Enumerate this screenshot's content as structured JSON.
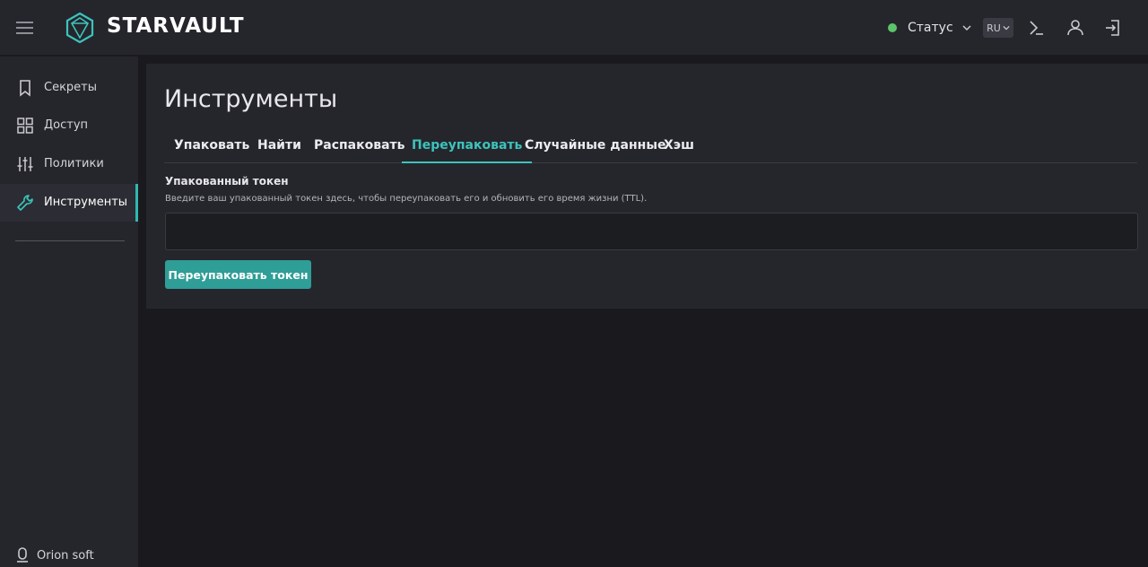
{
  "header": {
    "brand": "STARVAULT",
    "status_label": "Статус",
    "lang": "RU",
    "icons": [
      "menu-icon",
      "logo-icon",
      "chevron-down-icon",
      "terminal-icon",
      "user-icon",
      "logout-icon"
    ],
    "status_color": "#5cc46a"
  },
  "sidebar": {
    "items": [
      {
        "label": "Секреты",
        "icon": "bookmark-icon",
        "active": false
      },
      {
        "label": "Доступ",
        "icon": "grid-icon",
        "active": false
      },
      {
        "label": "Политики",
        "icon": "sliders-icon",
        "active": false
      },
      {
        "label": "Инструменты",
        "icon": "wrench-icon",
        "active": true
      }
    ],
    "footer": "Orion soft"
  },
  "main": {
    "title": "Инструменты",
    "tabs": [
      {
        "label": "Упаковать",
        "active": false
      },
      {
        "label": "Найти",
        "active": false
      },
      {
        "label": "Распаковать",
        "active": false
      },
      {
        "label": "Переупаковать",
        "active": true
      },
      {
        "label": "Случайные данные",
        "active": false
      },
      {
        "label": "Хэш",
        "active": false
      }
    ],
    "field_label": "Упакованный токен",
    "field_help": "Введите ваш упакованный токен здесь, чтобы переупаковать его и обновить его время жизни (TTL).",
    "token_value": "",
    "token_placeholder": "",
    "submit_label": "Переупаковать токен"
  },
  "colors": {
    "accent": "#3cc4bc",
    "button": "#2e9e97",
    "background": "#1a1a1e",
    "panel": "#25262c"
  }
}
